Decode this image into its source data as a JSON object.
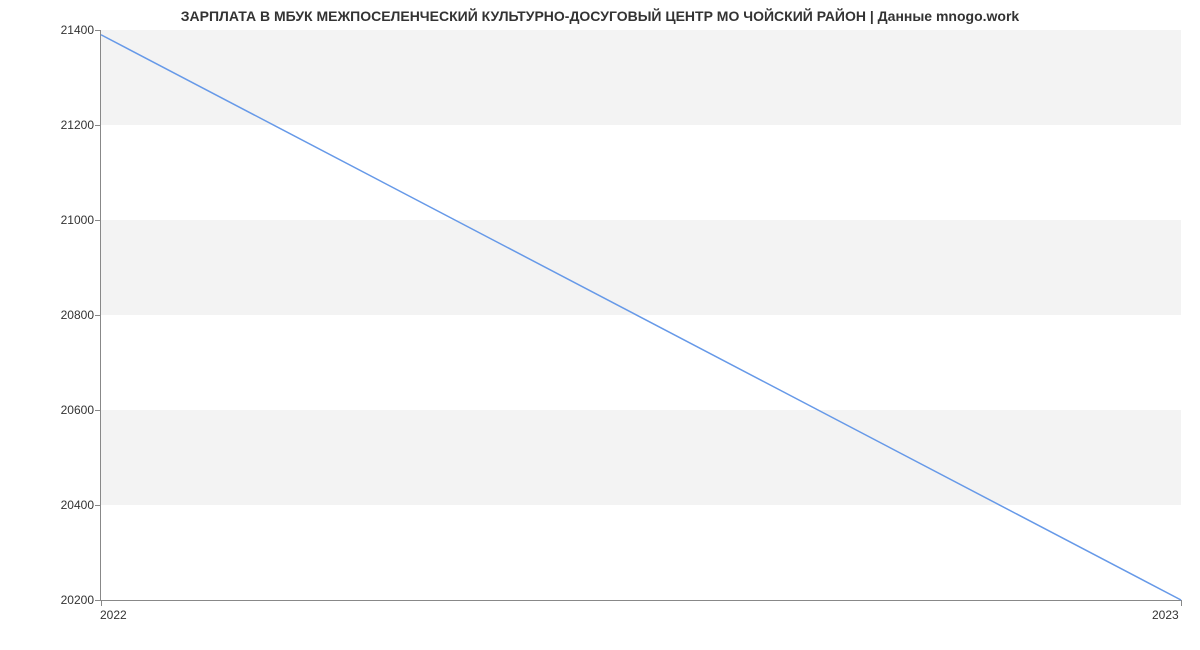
{
  "chart_data": {
    "type": "line",
    "title": "ЗАРПЛАТА В МБУК МЕЖПОСЕЛЕНЧЕСКИЙ КУЛЬТУРНО-ДОСУГОВЫЙ ЦЕНТР МО ЧОЙСКИЙ РАЙОН | Данные mnogo.work",
    "x": [
      2022,
      2023
    ],
    "values": [
      21390,
      20200
    ],
    "xticks": [
      2022,
      2023
    ],
    "yticks": [
      20200,
      20400,
      20600,
      20800,
      21000,
      21200,
      21400
    ],
    "xlim": [
      2022,
      2023
    ],
    "ylim": [
      20200,
      21400
    ],
    "xlabel": "",
    "ylabel": "",
    "line_color": "#6699e8",
    "band_color": "#f3f3f3"
  }
}
